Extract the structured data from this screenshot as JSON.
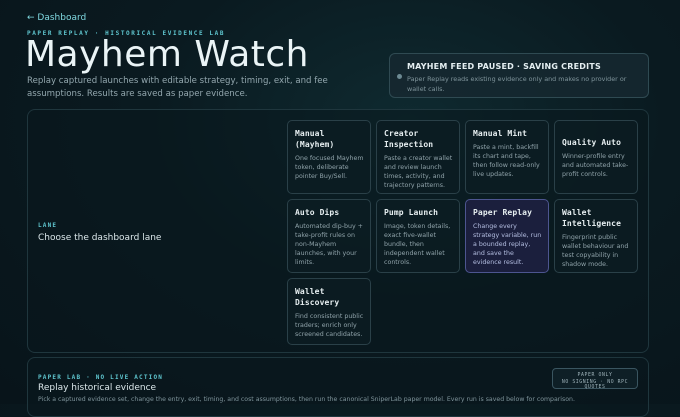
{
  "nav": {
    "back_label": "← Dashboard"
  },
  "header": {
    "eyebrow": "PAPER REPLAY · HISTORICAL EVIDENCE LAB",
    "title": "Mayhem Watch",
    "subtitle": "Replay captured launches with editable strategy, timing, exit, and fee assumptions. Results are saved as paper evidence."
  },
  "notice": {
    "heading": "MAYHEM FEED PAUSED · SAVING CREDITS",
    "body": "Paper Replay reads existing evidence only and makes no provider or wallet calls."
  },
  "lane": {
    "eyebrow": "LANE",
    "title": "Choose the dashboard lane",
    "cards": [
      {
        "title": "Manual (Mayhem)",
        "desc": "One focused Mayhem token, deliberate pointer Buy/Sell."
      },
      {
        "title": "Creator Inspection",
        "desc": "Paste a creator wallet and review launch times, activity, and trajectory patterns."
      },
      {
        "title": "Manual Mint",
        "desc": "Paste a mint, backfill its chart and tape, then follow read-only live updates."
      },
      {
        "title": "Quality Auto",
        "desc": "Winner-profile entry and automated take-profit controls."
      },
      {
        "title": "Auto Dips",
        "desc": "Automated dip-buy + take-profit rules on non-Mayhem launches, with your limits."
      },
      {
        "title": "Pump Launch",
        "desc": "Image, token details, exact five-wallet bundle, then independent wallet controls."
      },
      {
        "title": "Paper Replay",
        "desc": "Change every strategy variable, run a bounded replay, and save the evidence result."
      },
      {
        "title": "Wallet Intelligence",
        "desc": "Fingerprint public wallet behaviour and test copyability in shadow mode."
      },
      {
        "title": "Wallet Discovery",
        "desc": "Find consistent public traders; enrich only screened candidates."
      }
    ]
  },
  "replay": {
    "eyebrow": "PAPER LAB · NO LIVE ACTION",
    "title": "Replay historical evidence",
    "desc": "Pick a captured evidence set, change the entry, exit, timing, and cost assumptions, then run the canonical SniperLab paper model. Every run is saved below for comparison.",
    "badge_line1": "PAPER ONLY",
    "badge_line2": "NO SIGNING · NO RPC QUOTES"
  },
  "colors": {
    "accent": "#5fc6cf",
    "background": "#0a1a20",
    "active_card": "#1b1f3d"
  }
}
